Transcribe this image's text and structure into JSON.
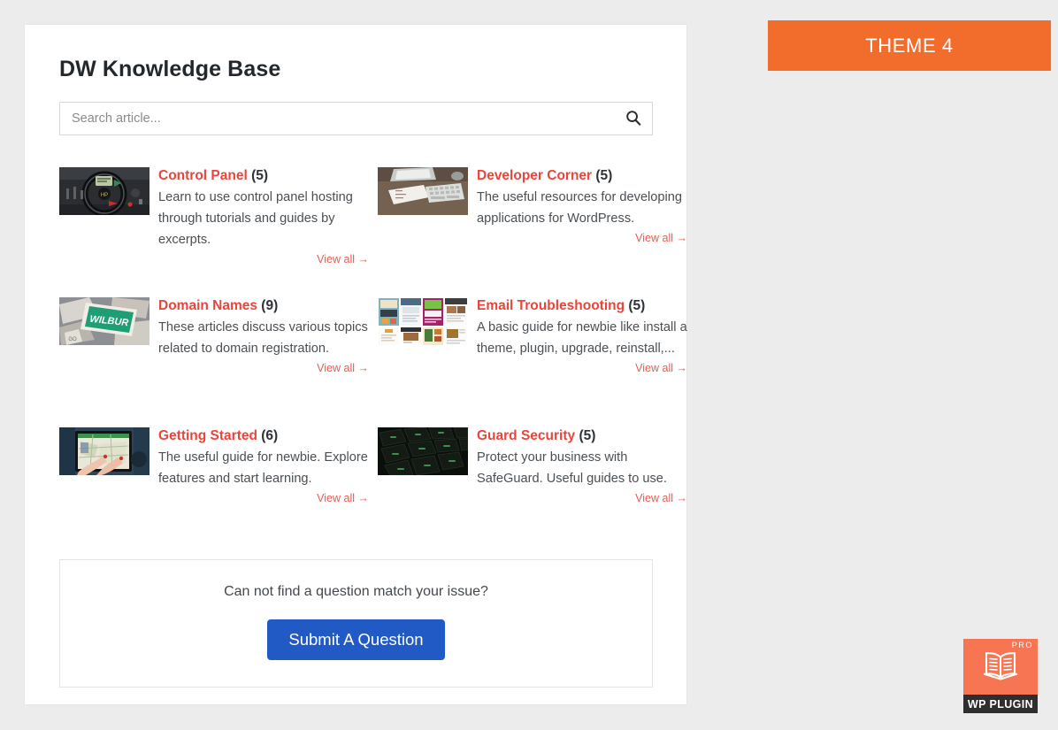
{
  "page": {
    "title": "DW Knowledge Base"
  },
  "search": {
    "value": "",
    "placeholder": "Search article...",
    "icon": "search-icon"
  },
  "categories": [
    {
      "name": "Control Panel",
      "count": "(5)",
      "description": "Learn to use control panel hosting through tutorials and guides by excerpts.",
      "view_all": "View all →",
      "thumbnail": "car-dashboard-steering-wheel-photo"
    },
    {
      "name": "Developer Corner",
      "count": "(5)",
      "description": "The useful resources for developing applications for WordPress.",
      "view_all": "View all →",
      "thumbnail": "keyboard-on-desk-photo"
    },
    {
      "name": "Domain Names",
      "count": "(9)",
      "description": "These articles discuss various topics related to domain registration.",
      "view_all": "View all →",
      "thumbnail": "wilbur-green-name-tag-photo"
    },
    {
      "name": "Email Troubleshooting",
      "count": "(5)",
      "description": "A basic guide for newbie like install a theme, plugin, upgrade, reinstall,...",
      "view_all": "View all →",
      "thumbnail": "email-templates-grid-photo"
    },
    {
      "name": "Getting Started",
      "count": "(6)",
      "description": "The useful guide for newbie. Explore features and start learning.",
      "view_all": "View all →",
      "thumbnail": "hands-using-tablet-map-photo"
    },
    {
      "name": "Guard Security",
      "count": "(5)",
      "description": "Protect your business with SafeGuard. Useful guides to use.",
      "view_all": "View all →",
      "thumbnail": "backlit-keyboard-keys-photo"
    }
  ],
  "cta": {
    "text": "Can not find a question match your issue?",
    "button_label": "Submit A Question"
  },
  "theme_banner": {
    "label": "THEME 4"
  },
  "pro_badge": {
    "pro_label": "PRO",
    "plugin_label": "WP PLUGIN",
    "icon": "open-book-icon"
  },
  "colors": {
    "accent_red": "#e8453c",
    "link_red": "#ec5a4e",
    "banner_orange": "#f26c2b",
    "badge_orange": "#f87553",
    "button_blue": "#2159c5",
    "page_background": "#ececec"
  }
}
